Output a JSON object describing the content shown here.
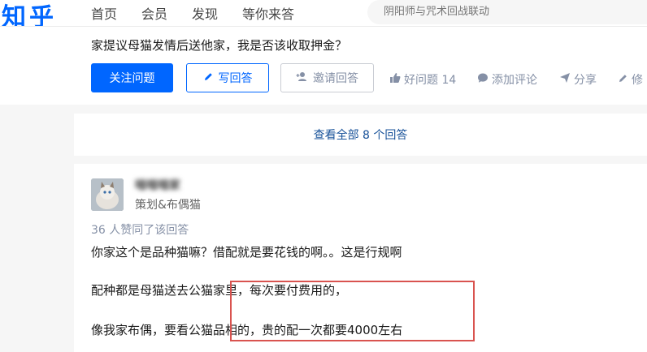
{
  "nav": {
    "logo": "知乎",
    "items": [
      "首页",
      "会员",
      "发现",
      "等你来答"
    ],
    "search_placeholder": "阴阳师与咒术回战联动"
  },
  "question": {
    "title": "家提议母猫发情后送他家，我是否该收取押金？",
    "follow_label": "关注问题",
    "write_label": "写回答",
    "invite_label": "邀请回答",
    "good_question_label": "好问题 14",
    "comment_label": "添加评论",
    "share_label": "分享",
    "edit_label": "修"
  },
  "view_all_label": "查看全部 8 个回答",
  "answer": {
    "author_name": "喵喵喵家",
    "author_bio": "策划&布偶猫",
    "votes_label": "36 人赞同了该回答",
    "paragraphs": [
      "你家这个是品种猫嘛？借配就是要花钱的啊。。这是行规啊",
      "配种都是母猫送去公猫家里，每次要付费用的，",
      "像我家布偶，要看公猫品相的，贵的配一次都要4000左右"
    ]
  },
  "colors": {
    "brand": "#0066ff",
    "link": "#175199",
    "highlight_box": "#d9534f"
  },
  "icons": {
    "write": "pencil-icon",
    "invite": "add-user-icon",
    "good": "thumbs-up-icon",
    "comment": "comment-bubble-icon",
    "share": "paper-plane-icon",
    "edit": "pencil-icon"
  }
}
